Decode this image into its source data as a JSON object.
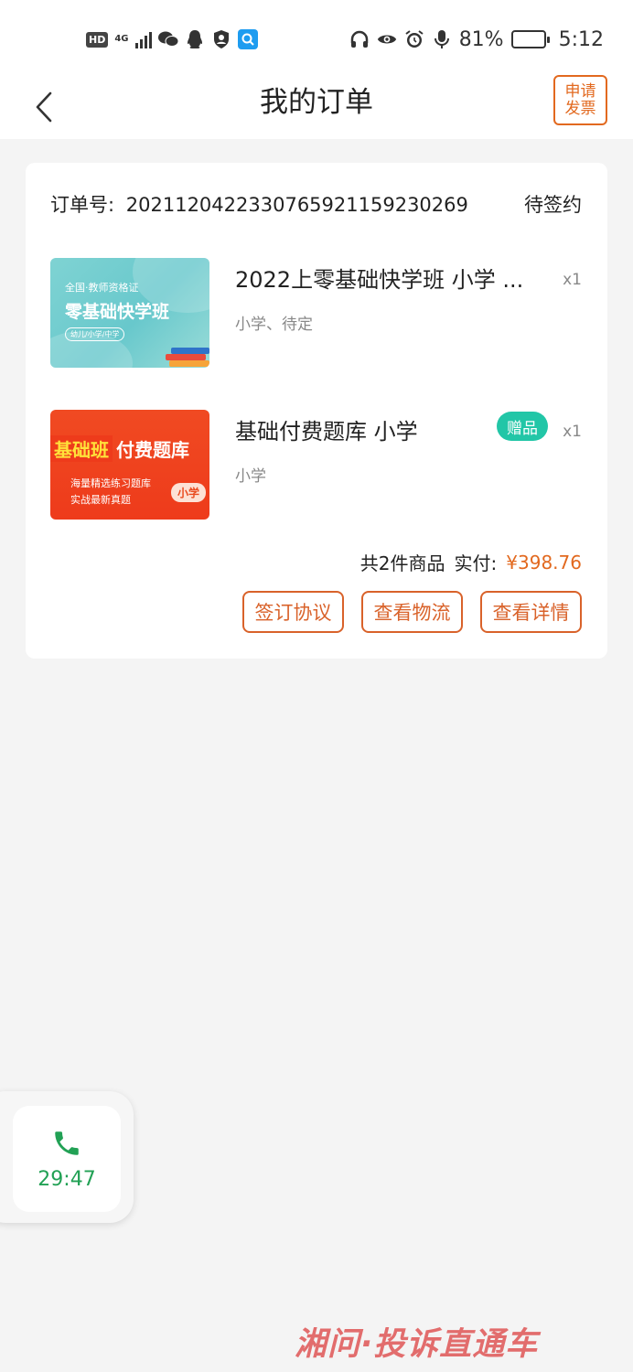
{
  "status_bar": {
    "hd": "HD",
    "network": "4G",
    "battery": "81%",
    "battery_level": 0.81,
    "time": "5:12",
    "icons_left": [
      "hd-icon",
      "signal-icon",
      "wechat-icon",
      "qq-icon",
      "shield-icon",
      "search-app-icon"
    ],
    "icons_right": [
      "headphones-icon",
      "eye-icon",
      "alarm-icon",
      "mic-icon",
      "battery-icon"
    ]
  },
  "nav": {
    "title": "我的订单",
    "invoice_line1": "申请",
    "invoice_line2": "发票"
  },
  "order": {
    "order_no_label": "订单号:",
    "order_no": "2021120422330765921159230269",
    "status": "待签约",
    "items": [
      {
        "title": "2022上零基础快学班 小学 ...",
        "subtitle": "小学、待定",
        "qty": "x1",
        "thumb_small": "全国·教师资格证",
        "thumb_big": "零基础快学班",
        "thumb_pill": "幼儿/小学/中学"
      },
      {
        "title": "基础付费题库 小学",
        "subtitle": "小学",
        "qty": "x1",
        "badge": "赠品",
        "thumb_head_left": "基础班",
        "thumb_head_right": "付费题库",
        "thumb_line1": "海量精选练习题库",
        "thumb_line2": "实战最新真题",
        "thumb_tag": "小学"
      }
    ],
    "summary_count": "共2件商品",
    "summary_paid_label": "实付:",
    "summary_price": "¥398.76",
    "actions": {
      "sign": "签订协议",
      "logistics": "查看物流",
      "details": "查看详情"
    }
  },
  "call": {
    "time": "29:47",
    "accent": "#22a155"
  },
  "watermark": "湘问·投诉直通车",
  "colors": {
    "accent": "#e2691f",
    "gift": "#22c6a7",
    "background": "#f4f4f4"
  }
}
